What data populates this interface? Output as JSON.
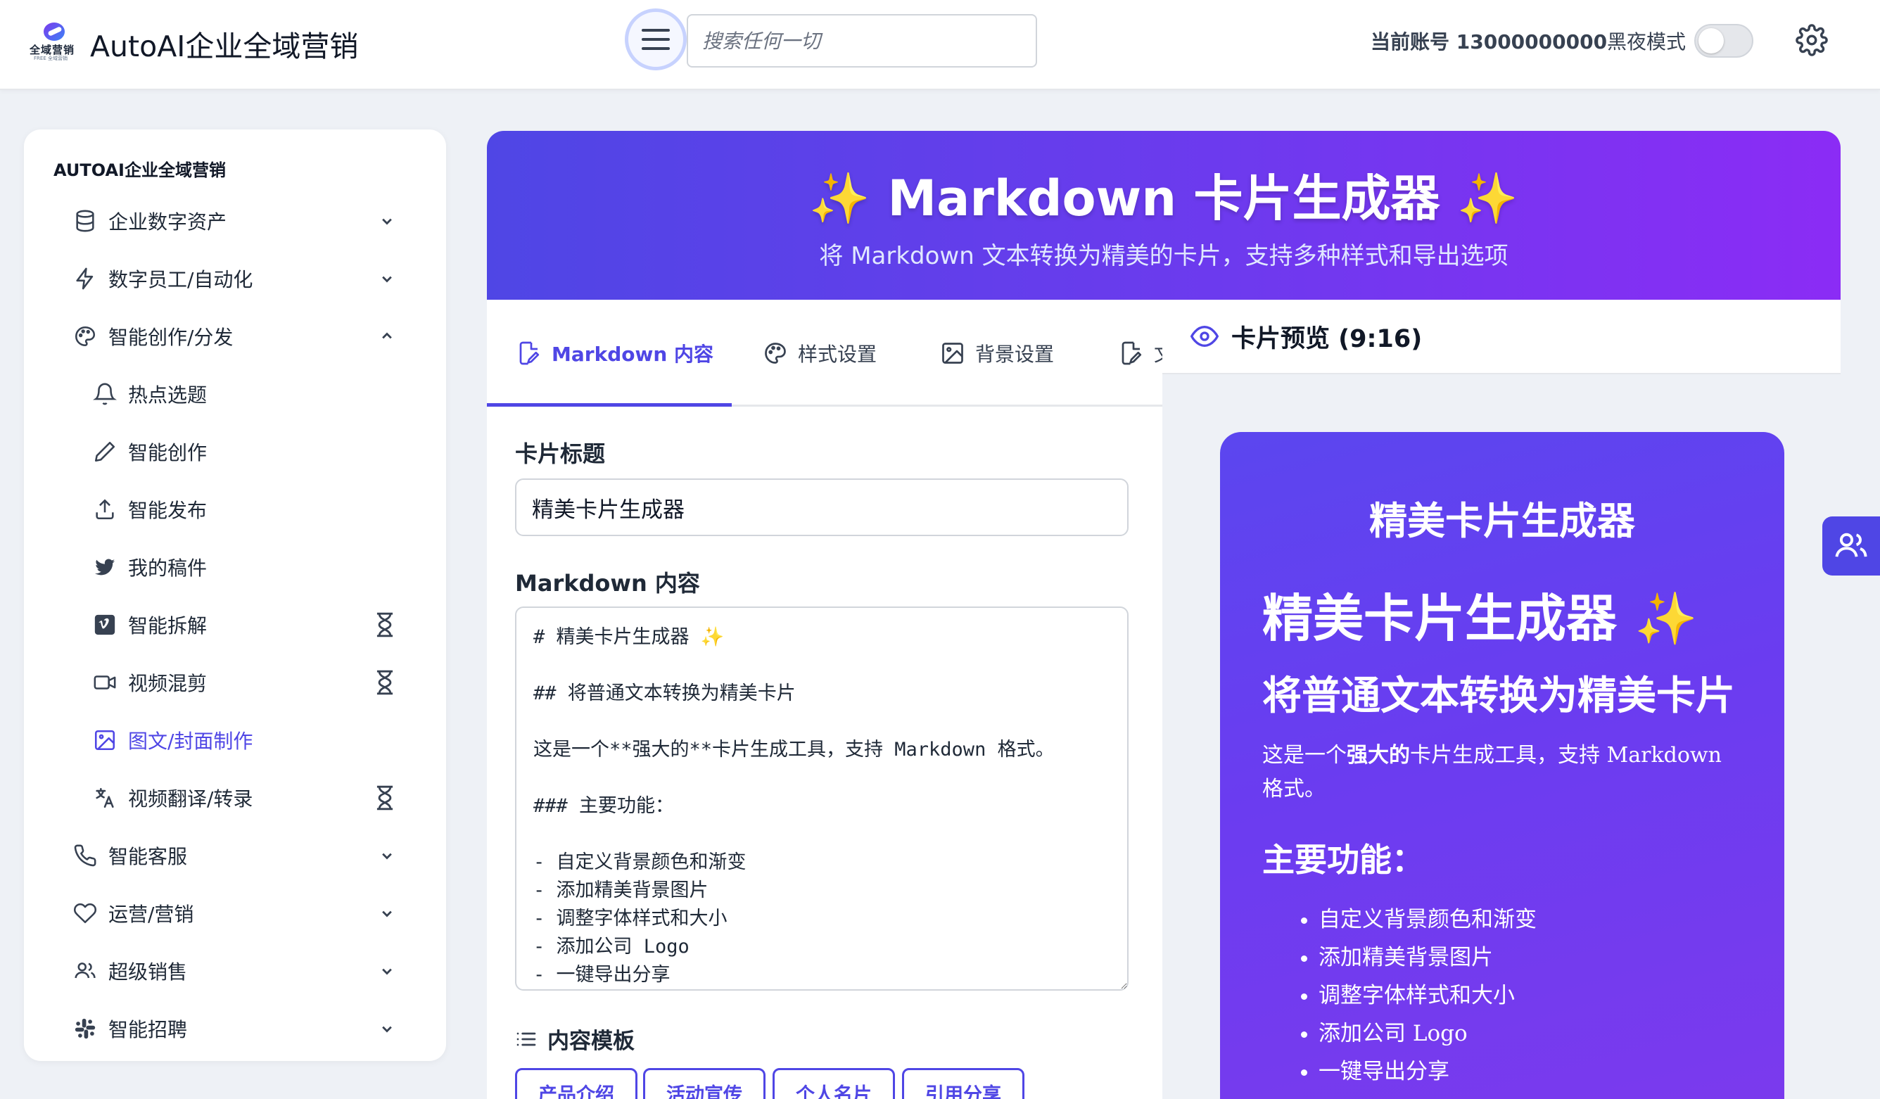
{
  "header": {
    "logo_text": "全域营销",
    "logo_subtext": "FREE 全域营销",
    "app_title": "AutoAI企业全域营销",
    "search_placeholder": "搜索任何一切",
    "account": "当前账号 13000000000",
    "dark_mode_label": "黑夜模式",
    "dark_mode_on": false
  },
  "sidebar": {
    "heading": "AUTOAI企业全域营销",
    "items": [
      {
        "label": "企业数字资产",
        "icon": "database-icon",
        "level": "top",
        "expandable": "chevron-down"
      },
      {
        "label": "数字员工/自动化",
        "icon": "bolt-icon",
        "level": "top",
        "expandable": "chevron-down"
      },
      {
        "label": "智能创作/分发",
        "icon": "palette-icon",
        "level": "top",
        "expandable": "chevron-up"
      },
      {
        "label": "热点选题",
        "icon": "bell-icon",
        "level": "sub"
      },
      {
        "label": "智能创作",
        "icon": "pencil-icon",
        "level": "sub"
      },
      {
        "label": "智能发布",
        "icon": "upload-icon",
        "level": "sub"
      },
      {
        "label": "我的稿件",
        "icon": "twitter-icon",
        "level": "sub"
      },
      {
        "label": "智能拆解",
        "icon": "vimeo-icon",
        "level": "sub",
        "badge": "hourglass-icon"
      },
      {
        "label": "视频混剪",
        "icon": "video-icon",
        "level": "sub",
        "badge": "hourglass-icon"
      },
      {
        "label": "图文/封面制作",
        "icon": "image-icon",
        "level": "sub",
        "active": true
      },
      {
        "label": "视频翻译/转录",
        "icon": "translate-icon",
        "level": "sub",
        "badge": "hourglass-icon"
      },
      {
        "label": "智能客服",
        "icon": "phone-icon",
        "level": "top",
        "expandable": "chevron-down"
      },
      {
        "label": "运营/营销",
        "icon": "heart-icon",
        "level": "top",
        "expandable": "chevron-down"
      },
      {
        "label": "超级销售",
        "icon": "users-icon",
        "level": "top",
        "expandable": "chevron-down"
      },
      {
        "label": "智能招聘",
        "icon": "slack-icon",
        "level": "top",
        "expandable": "chevron-down"
      }
    ]
  },
  "hero": {
    "spark": "✨",
    "title": "Markdown 卡片生成器",
    "subtitle": "将 Markdown 文本转换为精美的卡片，支持多种样式和导出选项"
  },
  "editor": {
    "tabs": [
      {
        "label": "Markdown 内容",
        "icon": "edit-icon",
        "active": true
      },
      {
        "label": "样式设置",
        "icon": "palette-icon"
      },
      {
        "label": "背景设置",
        "icon": "image-icon"
      },
      {
        "label": "文",
        "icon": "edit-icon"
      }
    ],
    "title_label": "卡片标题",
    "title_value": "精美卡片生成器",
    "markdown_label": "Markdown 内容",
    "markdown_value": "# 精美卡片生成器 ✨\n\n## 将普通文本转换为精美卡片\n\n这是一个**强大的**卡片生成工具，支持 Markdown 格式。\n\n### 主要功能：\n\n- 自定义背景颜色和渐变\n- 添加精美背景图片\n- 调整字体样式和大小\n- 添加公司 Logo\n- 一键导出分享",
    "templates_label": "内容模板",
    "templates": [
      "产品介绍",
      "活动宣传",
      "个人名片",
      "引用分享"
    ]
  },
  "preview": {
    "heading": "卡片预览 (9:16)",
    "card_title": "精美卡片生成器",
    "h1": "精美卡片生成器",
    "h1_spark": "✨",
    "h2": "将普通文本转换为精美卡片",
    "p_before": "这是一个",
    "p_bold": "强大的",
    "p_after": "卡片生成工具，支持 Markdown 格式。",
    "h3": "主要功能：",
    "list": [
      "自定义背景颜色和渐变",
      "添加精美背景图片",
      "调整字体样式和大小",
      "添加公司 Logo",
      "一键导出分享"
    ]
  },
  "colors": {
    "accent": "#4f46e5",
    "hero_gradient_start": "#4f46e5",
    "hero_gradient_end": "#8b2cf5",
    "page_background": "#eef1f6"
  }
}
